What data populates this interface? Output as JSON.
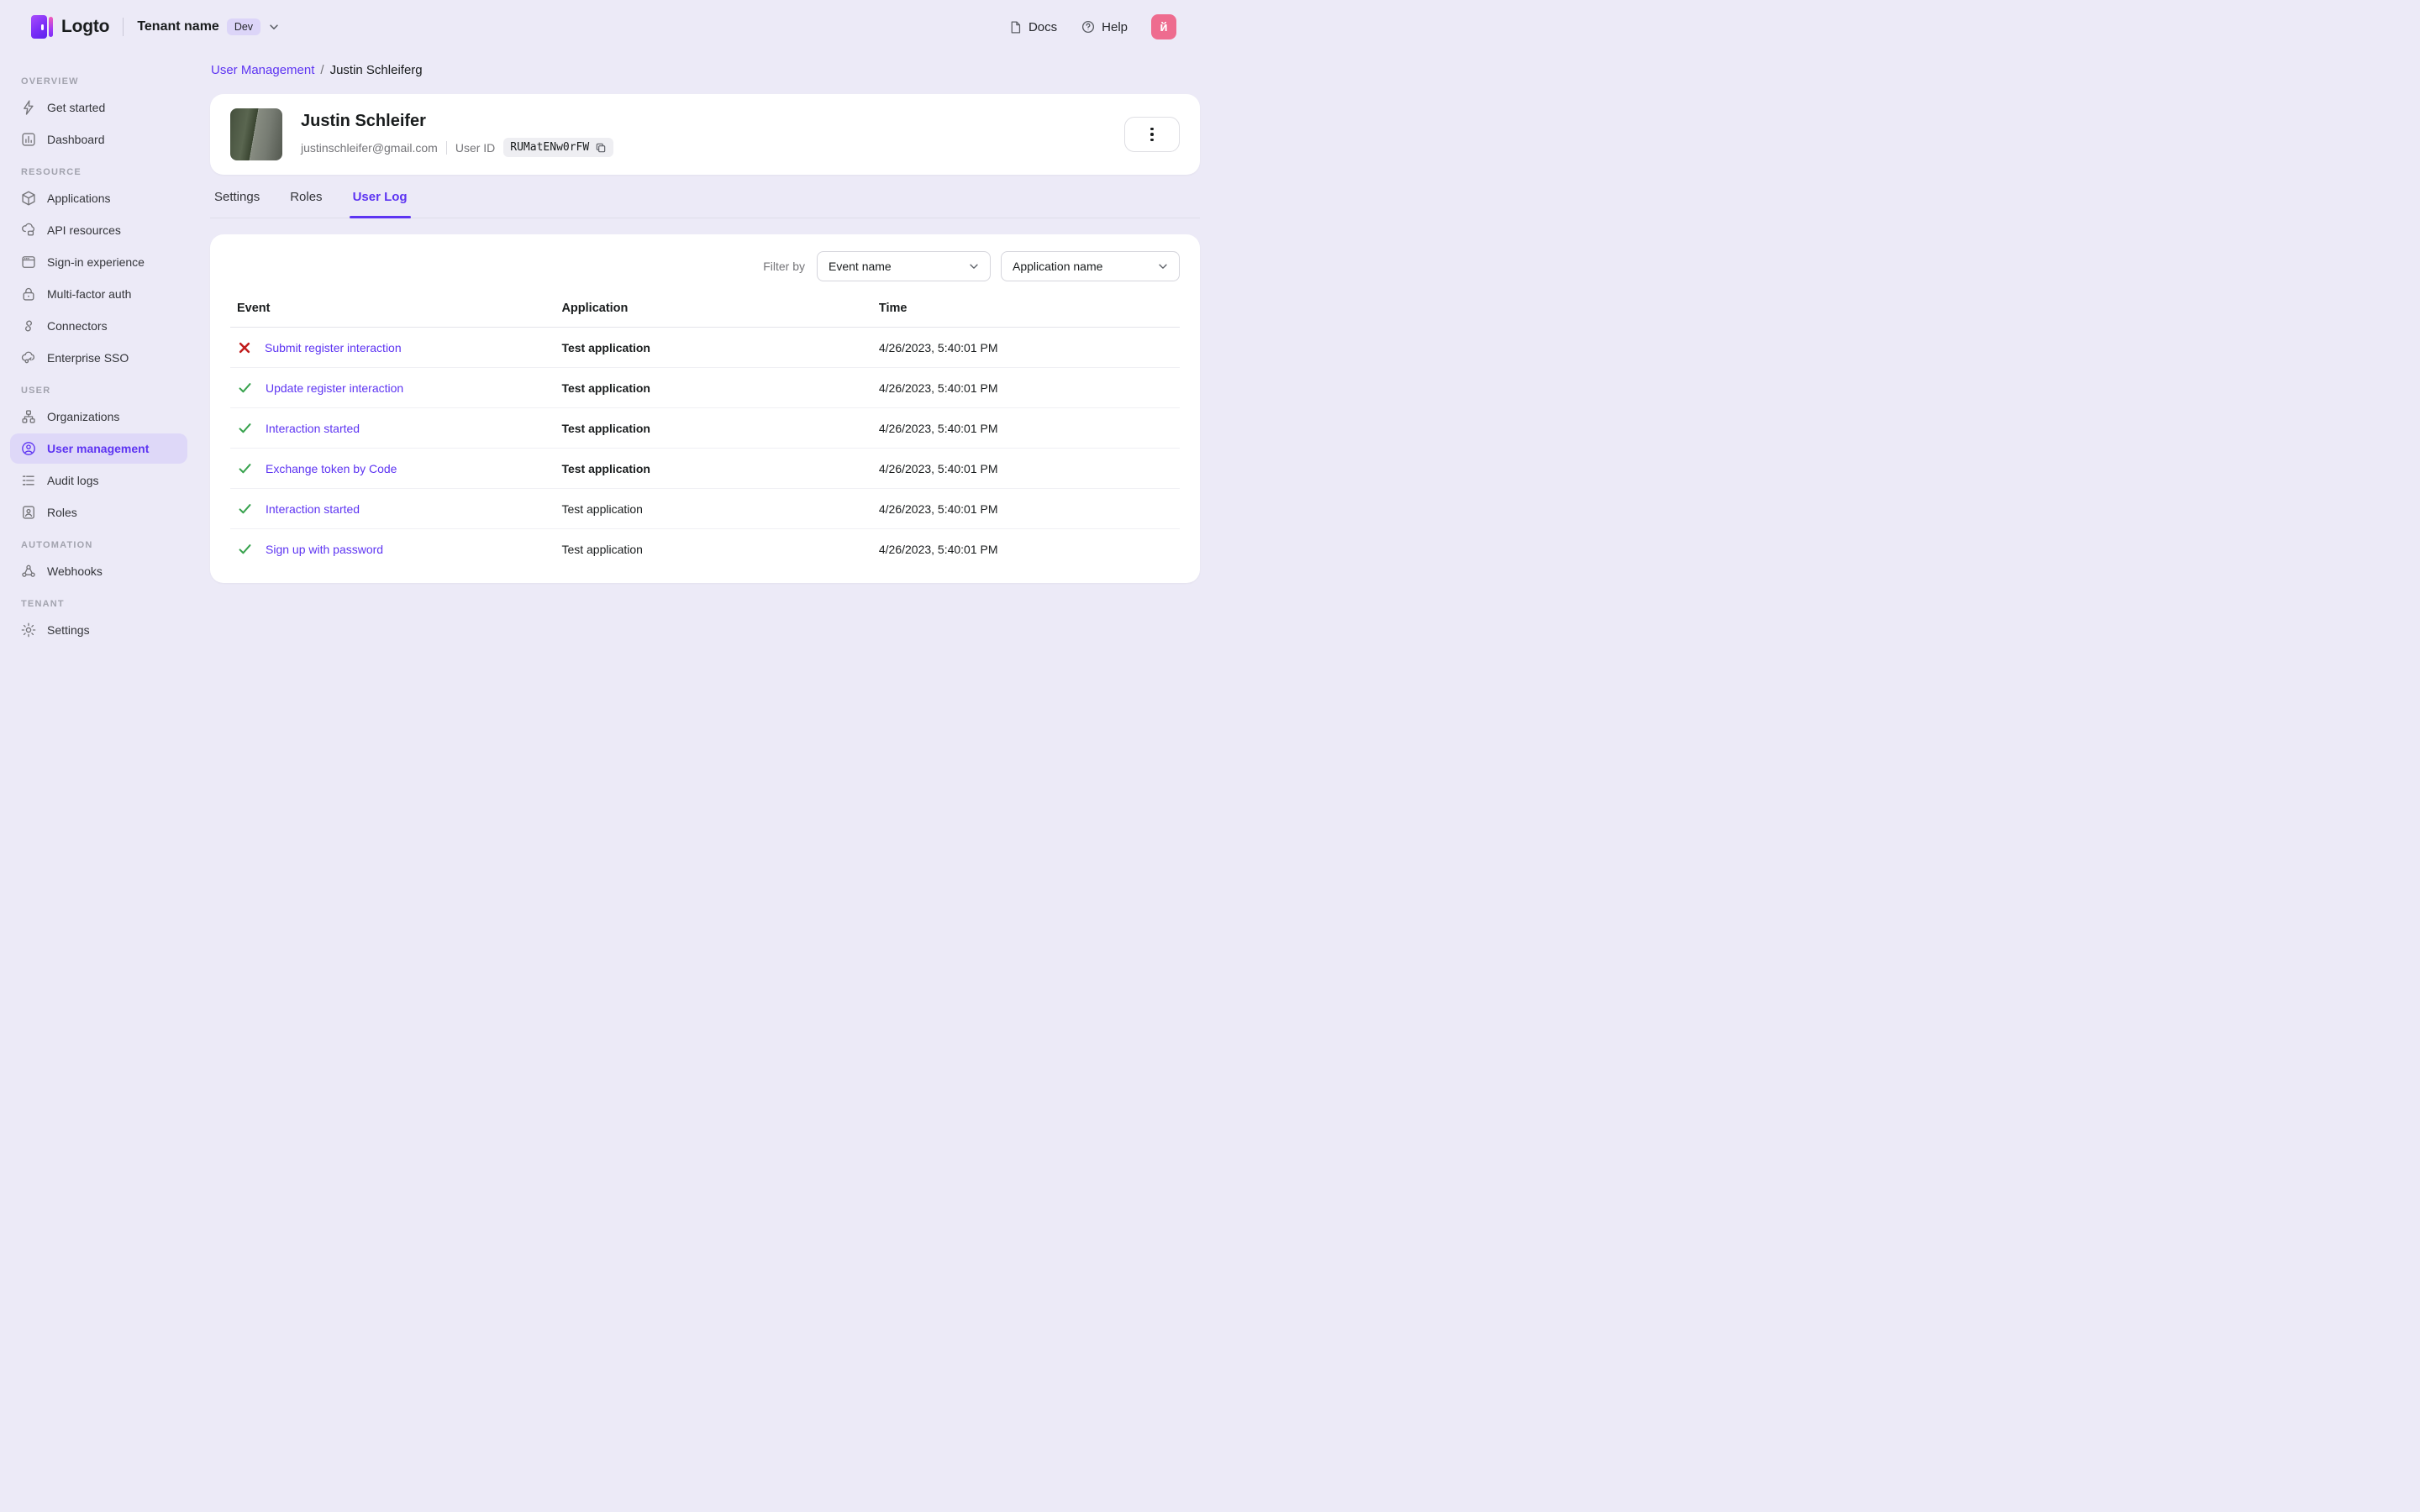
{
  "topbar": {
    "brand": "Logto",
    "tenant_name": "Tenant name",
    "tenant_badge": "Dev",
    "docs_label": "Docs",
    "help_label": "Help",
    "avatar_letter": "й"
  },
  "sidebar": {
    "sections": [
      {
        "label": "OVERVIEW",
        "items": [
          {
            "icon": "bolt",
            "label": "Get started",
            "active": false
          },
          {
            "icon": "dashboard",
            "label": "Dashboard",
            "active": false
          }
        ]
      },
      {
        "label": "RESOURCE",
        "items": [
          {
            "icon": "cube",
            "label": "Applications",
            "active": false
          },
          {
            "icon": "api",
            "label": "API resources",
            "active": false
          },
          {
            "icon": "browser",
            "label": "Sign-in experience",
            "active": false
          },
          {
            "icon": "lock",
            "label": "Multi-factor auth",
            "active": false
          },
          {
            "icon": "connectors",
            "label": "Connectors",
            "active": false
          },
          {
            "icon": "sso",
            "label": "Enterprise SSO",
            "active": false
          }
        ]
      },
      {
        "label": "USER",
        "items": [
          {
            "icon": "org",
            "label": "Organizations",
            "active": false
          },
          {
            "icon": "user",
            "label": "User management",
            "active": true
          },
          {
            "icon": "audit",
            "label": "Audit logs",
            "active": false
          },
          {
            "icon": "roles",
            "label": "Roles",
            "active": false
          }
        ]
      },
      {
        "label": "AUTOMATION",
        "items": [
          {
            "icon": "webhook",
            "label": "Webhooks",
            "active": false
          }
        ]
      },
      {
        "label": "TENANT",
        "items": [
          {
            "icon": "gear",
            "label": "Settings",
            "active": false
          }
        ]
      }
    ]
  },
  "breadcrumb": {
    "parent": "User Management",
    "separator": "/",
    "current": "Justin Schleiferg"
  },
  "user_card": {
    "name": "Justin Schleifer",
    "email": "justinschleifer@gmail.com",
    "user_id_label": "User ID",
    "user_id": "RUMatENw0rFW"
  },
  "tabs": [
    {
      "label": "Settings",
      "active": false
    },
    {
      "label": "Roles",
      "active": false
    },
    {
      "label": "User Log",
      "active": true
    }
  ],
  "log_panel": {
    "filter_label": "Filter by",
    "filters": [
      {
        "value": "Event name"
      },
      {
        "value": "Application name"
      }
    ],
    "table": {
      "columns": [
        "Event",
        "Application",
        "Time"
      ],
      "rows": [
        {
          "status": "fail",
          "event": "Submit register interaction",
          "application": "Test application",
          "app_emphasis": true,
          "time": "4/26/2023, 5:40:01 PM"
        },
        {
          "status": "success",
          "event": "Update register interaction",
          "application": "Test application",
          "app_emphasis": true,
          "time": "4/26/2023, 5:40:01 PM"
        },
        {
          "status": "success",
          "event": "Interaction started",
          "application": "Test application",
          "app_emphasis": true,
          "time": "4/26/2023, 5:40:01 PM"
        },
        {
          "status": "success",
          "event": "Exchange token by Code",
          "application": "Test application",
          "app_emphasis": true,
          "time": "4/26/2023, 5:40:01 PM"
        },
        {
          "status": "success",
          "event": "Interaction started",
          "application": "Test application",
          "app_emphasis": false,
          "time": "4/26/2023, 5:40:01 PM"
        },
        {
          "status": "success",
          "event": "Sign up with password",
          "application": "Test application",
          "app_emphasis": false,
          "time": "4/26/2023, 5:40:01 PM"
        }
      ]
    }
  },
  "colors": {
    "accent_purple": "#5D34F2",
    "page_background": "#ECEAF7",
    "active_item_background": "#DED8F8",
    "success_green": "#37A24D",
    "fail_red": "#C11C1C",
    "avatar_pink": "#EE6C8F"
  }
}
